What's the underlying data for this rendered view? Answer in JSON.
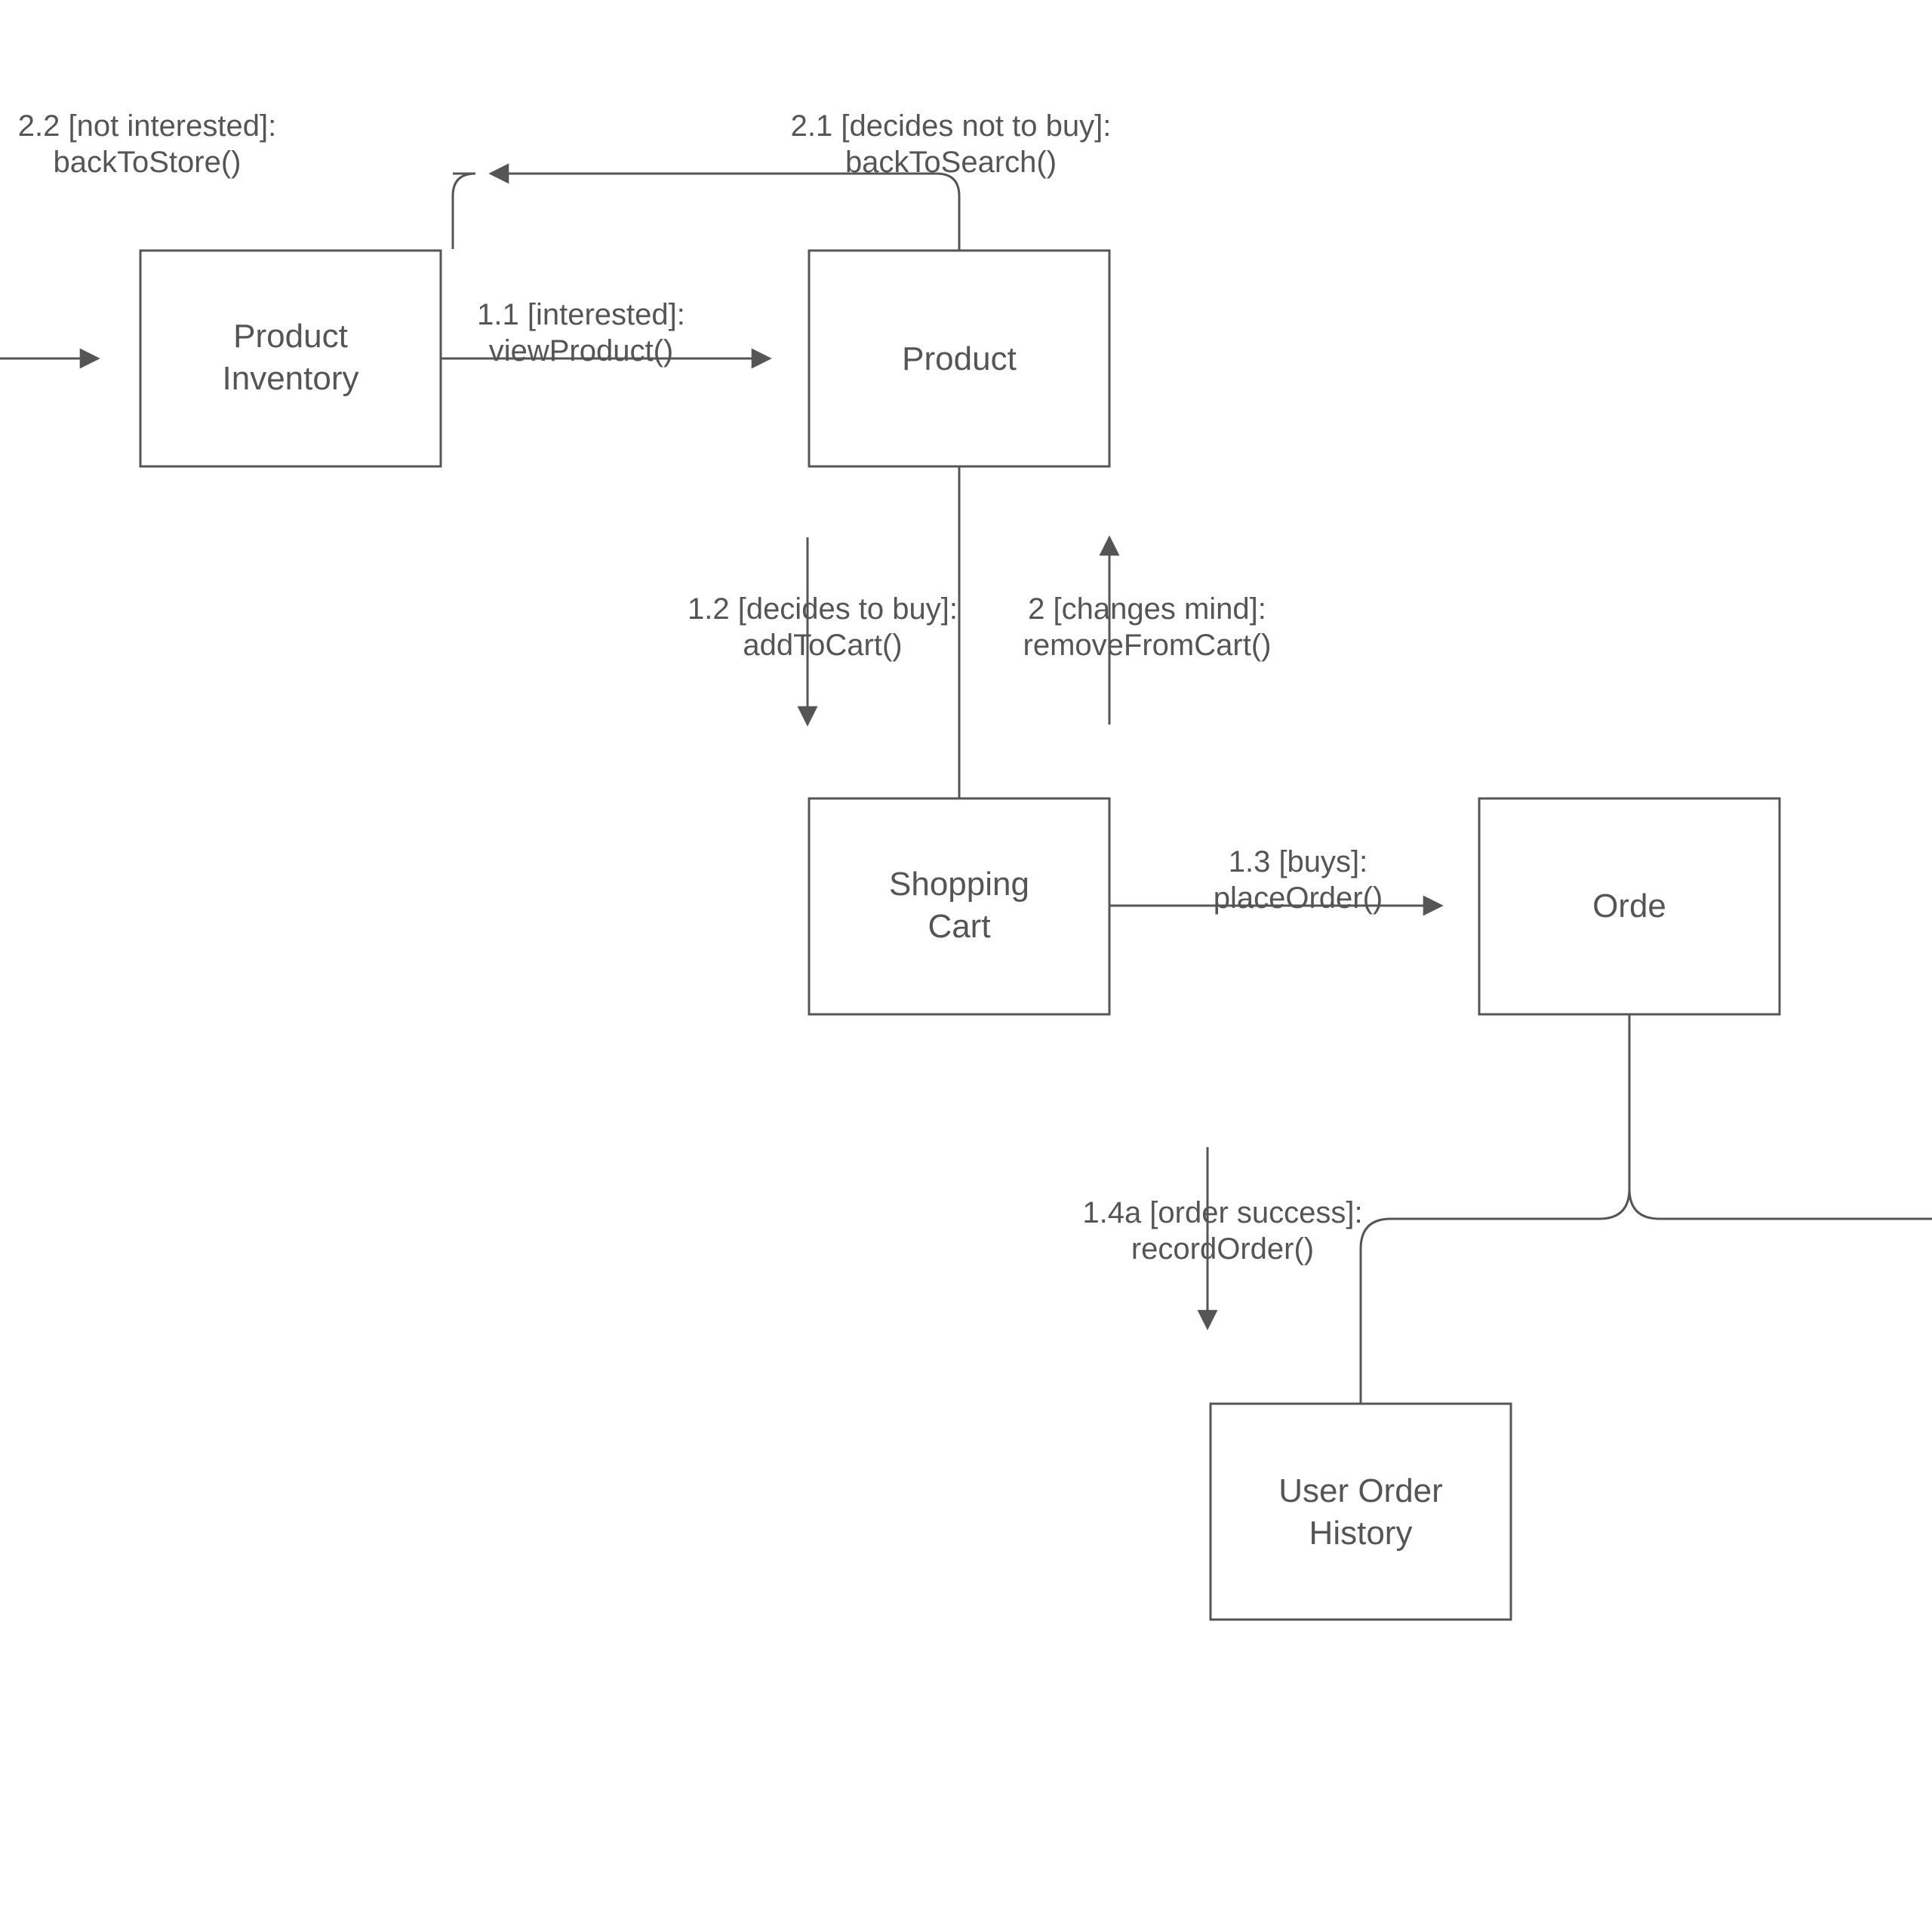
{
  "nodes": {
    "product_inventory": {
      "line1": "Product",
      "line2": "Inventory"
    },
    "product": {
      "line1": "Product"
    },
    "shopping_cart": {
      "line1": "Shopping",
      "line2": "Cart"
    },
    "order": {
      "line1": "Orde"
    },
    "user_order_history": {
      "line1": "User Order",
      "line2": "History"
    }
  },
  "edges": {
    "back_to_store": {
      "line1": "2.2 [not interested]:",
      "line2": "backToStore()"
    },
    "back_to_search": {
      "line1": "2.1 [decides not to buy]:",
      "line2": "backToSearch()"
    },
    "view_product": {
      "line1": "1.1 [interested]:",
      "line2": "viewProduct()"
    },
    "add_to_cart": {
      "line1": "1.2 [decides to buy]:",
      "line2": "addToCart()"
    },
    "remove_from_cart": {
      "line1": "2 [changes mind]:",
      "line2": "removeFromCart()"
    },
    "place_order": {
      "line1": "1.3 [buys]:",
      "line2": "placeOrder()"
    },
    "record_order": {
      "line1": "1.4a [order success]:",
      "line2": "recordOrder()"
    }
  }
}
